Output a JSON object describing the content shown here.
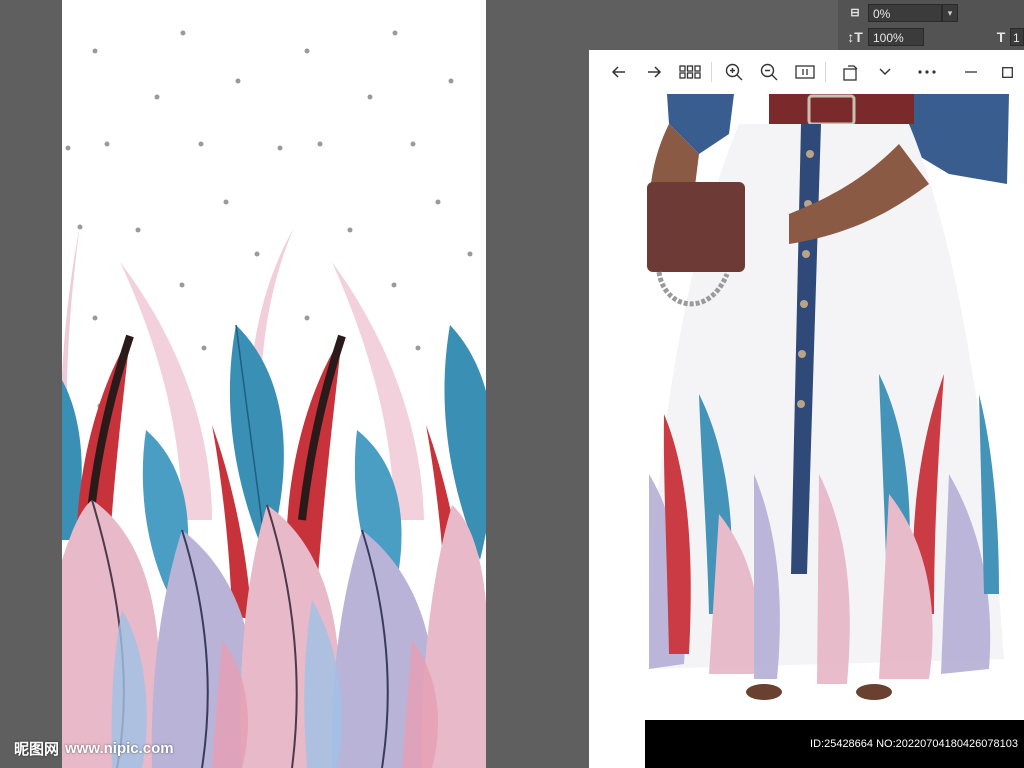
{
  "photoshop_panel": {
    "tracking_value": "0%",
    "vertical_scale_value": "100%",
    "horizontal_scale_partial": "1"
  },
  "viewer": {
    "toolbar": {
      "back": "back-arrow-icon",
      "forward": "forward-arrow-icon",
      "grid": "grid-view-icon",
      "zoom_in": "zoom-in-icon",
      "zoom_out": "zoom-out-icon",
      "fit": "fit-to-window-icon",
      "rotate": "rotate-icon",
      "more_dropdown": "chevron-down-icon",
      "more": "more-options-icon",
      "minimize": "minimize-icon",
      "maximize": "maximize-icon"
    },
    "image_id_text": "ID:25428664 NO:20220704180426078103"
  },
  "watermark": {
    "logo_text": "昵图网",
    "url_text": "www.nipic.com"
  },
  "colors": {
    "app_background": "#5f5f5f",
    "panel_background": "#535353",
    "feather_blue": "#3a8fb5",
    "feather_red": "#c8323a",
    "feather_pink": "#e8b9c9",
    "feather_lavender": "#b9b3d8",
    "denim": "#3a5d8f"
  }
}
